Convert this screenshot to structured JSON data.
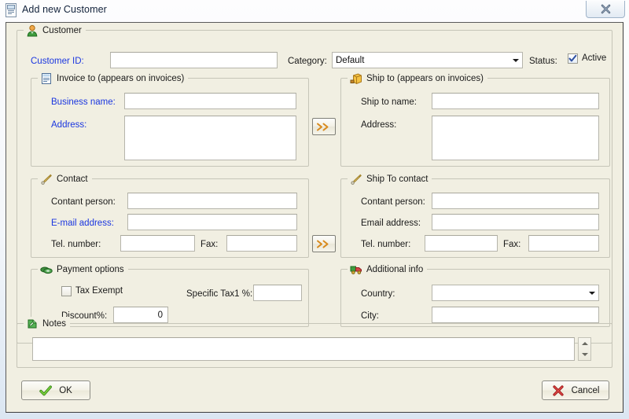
{
  "window": {
    "title": "Add new Customer",
    "title_icon": "document-card-icon",
    "close_label": "x"
  },
  "customer_group": {
    "caption": "Customer",
    "icon": "user-icon",
    "customer_id_label": "Customer ID:",
    "customer_id_value": "",
    "category_label": "Category:",
    "category_value": "Default",
    "category_options": [
      "Default"
    ],
    "status_label": "Status:",
    "active_label": "Active",
    "active_checked": true
  },
  "invoice_to": {
    "caption": "Invoice to (appears on invoices)",
    "icon": "invoice-document-icon",
    "business_name_label": "Business name:",
    "business_name_value": "",
    "address_label": "Address:",
    "address_value": ""
  },
  "ship_to": {
    "caption": "Ship to (appears on invoices)",
    "icon": "package-icon",
    "ship_to_name_label": "Ship to name:",
    "ship_to_name_value": "",
    "address_label": "Address:",
    "address_value": ""
  },
  "contact": {
    "caption": "Contact",
    "icon": "pen-icon",
    "contact_person_label": "Contant person:",
    "contact_person_value": "",
    "email_label": "E-mail address:",
    "email_value": "",
    "tel_label": "Tel. number:",
    "tel_value": "",
    "fax_label": "Fax:",
    "fax_value": ""
  },
  "ship_to_contact": {
    "caption": "Ship To contact",
    "icon": "pen-icon",
    "contact_person_label": "Contant person:",
    "contact_person_value": "",
    "email_label": "Email address:",
    "email_value": "",
    "tel_label": "Tel. number:",
    "tel_value": "",
    "fax_label": "Fax:",
    "fax_value": ""
  },
  "payment_options": {
    "caption": "Payment options",
    "icon": "money-icon",
    "tax_exempt_label": "Tax Exempt",
    "tax_exempt_checked": false,
    "specific_tax_label": "Specific Tax1 %:",
    "specific_tax_value": "",
    "discount_label": "Discount%:",
    "discount_value": "0"
  },
  "additional_info": {
    "caption": "Additional info",
    "icon": "truck-icon",
    "country_label": "Country:",
    "country_value": "",
    "city_label": "City:",
    "city_value": ""
  },
  "notes": {
    "caption": "Notes",
    "icon": "note-pencil-icon",
    "value": ""
  },
  "copy_buttons": {
    "invoice_to_ship_label": ">>",
    "contact_to_ship_label": ">>"
  },
  "footer": {
    "ok_label": "OK",
    "ok_icon": "green-check-icon",
    "cancel_label": "Cancel",
    "cancel_icon": "red-x-icon"
  },
  "colors": {
    "form_background": "#f1efe2",
    "link_blue": "#1a36e0",
    "title_text": "#12223b",
    "group_border": "#c6c5b8",
    "input_border": "#b6b5ab",
    "ok_green": "#4aa819",
    "cancel_red": "#b51a1a",
    "chevron_orange": "#d88a1d"
  }
}
